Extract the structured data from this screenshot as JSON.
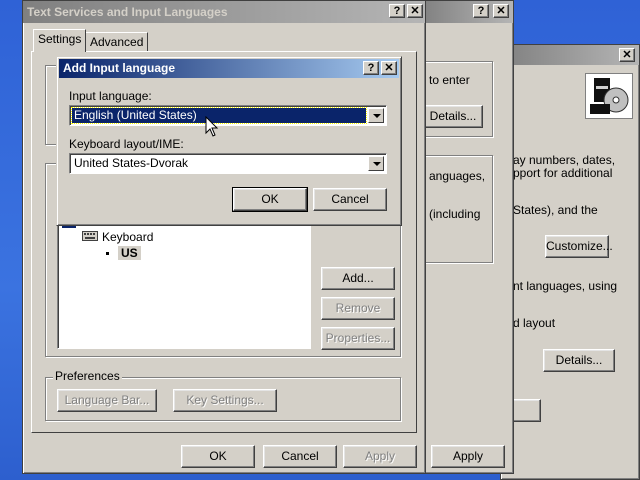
{
  "right_window": {
    "lines": [
      "ay numbers, dates,",
      "pport for additional",
      "States), and the",
      "nt languages, using",
      "d layout"
    ],
    "customize_label": "Customize...",
    "details_label": "Details..."
  },
  "middle_window": {
    "lines": [
      "to enter",
      "anguages,",
      "(including"
    ],
    "details_label": "Details...",
    "apply_label": "Apply"
  },
  "main_window": {
    "title": "Text Services and Input Languages",
    "tabs": [
      "Settings",
      "Advanced"
    ],
    "tree": {
      "category": "Keyboard",
      "item": "US"
    },
    "add_label": "Add...",
    "remove_label": "Remove",
    "properties_label": "Properties...",
    "preferences": {
      "title": "Preferences",
      "language_bar_label": "Language Bar...",
      "key_settings_label": "Key Settings..."
    },
    "ok_label": "OK",
    "cancel_label": "Cancel",
    "apply_label": "Apply"
  },
  "dialog": {
    "title": "Add Input language",
    "input_language_label": "Input language:",
    "input_language_value": "English (United States)",
    "keyboard_label": "Keyboard layout/IME:",
    "keyboard_value": "United States-Dvorak",
    "ok_label": "OK",
    "cancel_label": "Cancel"
  },
  "titlebar_buttons": {
    "help": "?",
    "close": "✕"
  }
}
